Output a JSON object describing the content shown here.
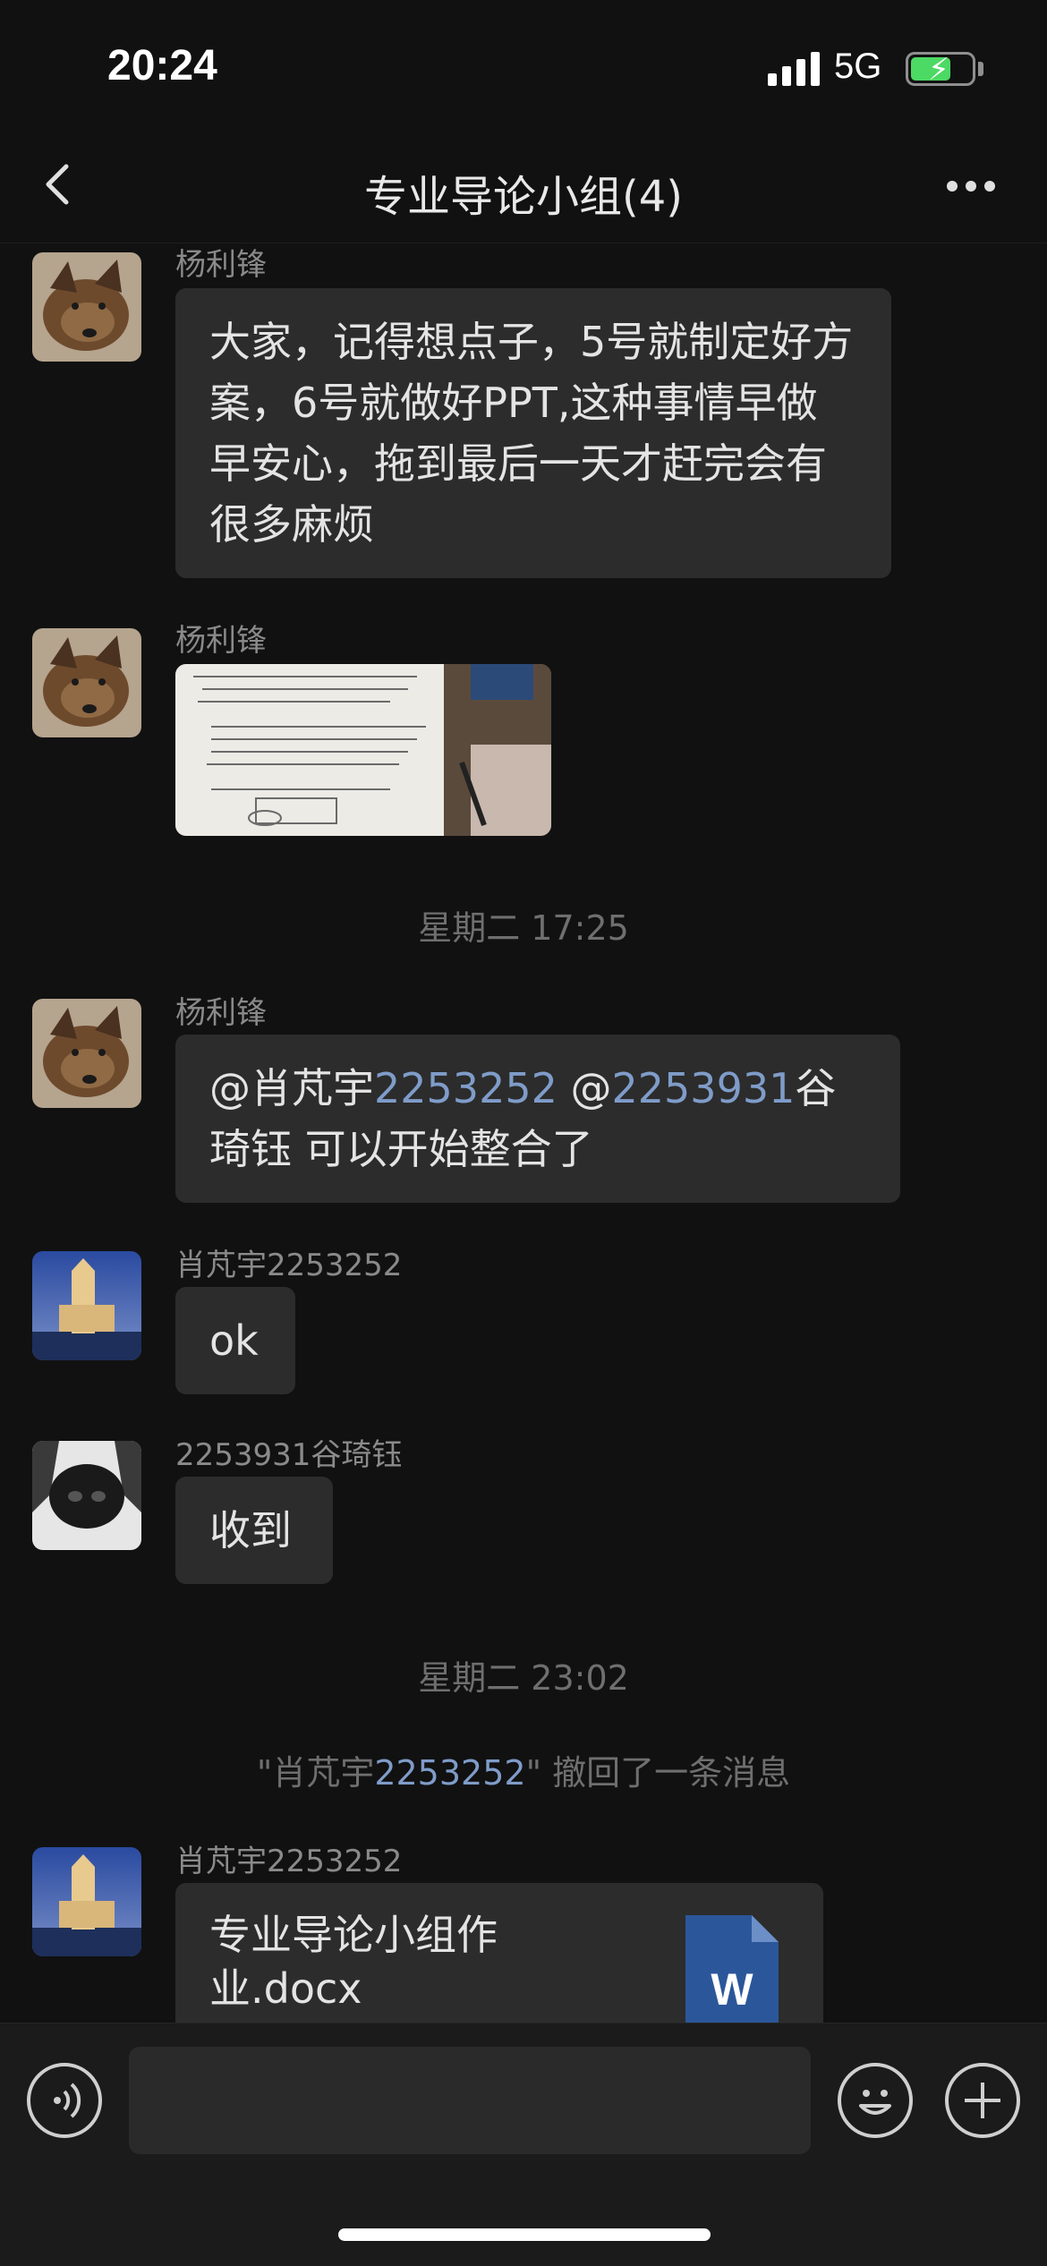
{
  "status_bar": {
    "time": "20:24",
    "network": "5G",
    "battery_icon": "battery-charging-icon"
  },
  "nav": {
    "title": "专业导论小组(4)",
    "back_icon": "chevron-left-icon",
    "more_icon": "more-dots-icon"
  },
  "messages": [
    {
      "sender": "杨利锋",
      "text": "大家，记得想点子，5号就制定好方案，6号就做好PPT,这种事情早做早安心，拖到最后一天才赶完会有很多麻烦"
    },
    {
      "sender": "杨利锋",
      "image": "handwritten-notes-photo"
    },
    {
      "timestamp": "星期二 17:25"
    },
    {
      "sender": "杨利锋",
      "parts": [
        "@肖芃宇",
        "2253252",
        " @",
        "2253931",
        "谷琦钰 可以开始整合了"
      ]
    },
    {
      "sender": "肖芃宇2253252",
      "text": "ok"
    },
    {
      "sender": "2253931谷琦钰",
      "text": "收到"
    },
    {
      "timestamp": "星期二 23:02"
    },
    {
      "recall_parts": [
        "\"肖芃宇",
        "2253252",
        "\" 撤回了一条消息"
      ]
    },
    {
      "sender": "肖芃宇2253252",
      "file_name": "专业导论小组作业.docx",
      "file_icon": "word-document-icon",
      "file_icon_letter": "W"
    }
  ],
  "input_bar": {
    "voice_icon": "voice-icon",
    "emoji_icon": "emoji-icon",
    "plus_icon": "plus-icon"
  },
  "colors": {
    "background": "#111111",
    "bubble": "#2c2c2c",
    "mention": "#7f9cc9",
    "word_blue": "#2b579a"
  }
}
